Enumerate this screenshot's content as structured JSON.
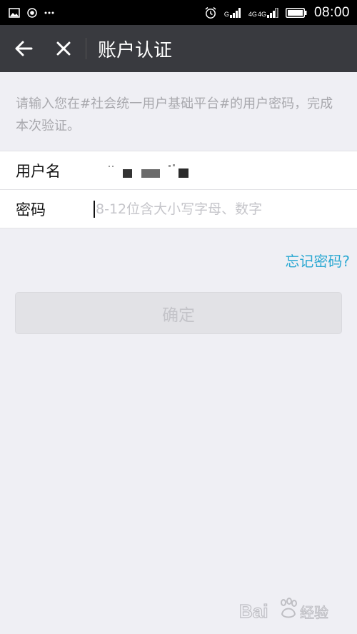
{
  "status_bar": {
    "time": "08:00",
    "net_1": "G",
    "net_2": "4G",
    "net_3": "4G",
    "icons": [
      "image-icon",
      "record-icon",
      "more-icon",
      "alarm-icon",
      "signal-icon",
      "signal-icon",
      "battery-icon"
    ]
  },
  "header": {
    "title": "账户认证",
    "back_icon": "back-arrow-icon",
    "close_icon": "close-icon"
  },
  "instruction": "请输入您在#社会统一用户基础平台#的用户密码，完成本次验证。",
  "form": {
    "username_label": "用户名",
    "username_value": "",
    "password_label": "密码",
    "password_placeholder": "8-12位含大小写字母、数字",
    "password_value": ""
  },
  "forgot_password": "忘记密码?",
  "confirm_button": "确定",
  "colors": {
    "header_bg": "#393a3f",
    "page_bg": "#efeff4",
    "link": "#2aa8d2",
    "button_disabled_bg": "#e2e2e6",
    "button_disabled_text": "#c4c4c9"
  },
  "watermark": {
    "text": "Bai 经验",
    "icon": "baidu-paw-icon"
  }
}
